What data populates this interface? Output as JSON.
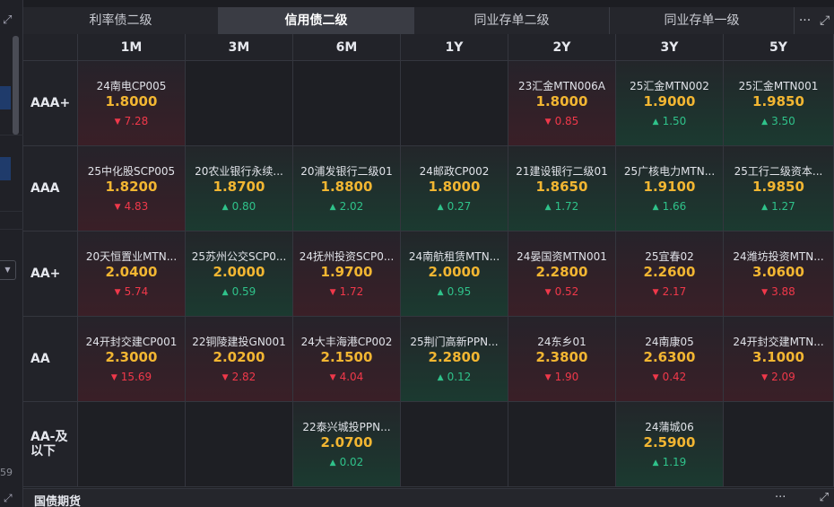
{
  "left": {
    "expand_icon": "expand-icon",
    "number": "59",
    "dropdown_icon": "chevron-down-icon"
  },
  "tabs": [
    {
      "label": "利率债二级",
      "active": false
    },
    {
      "label": "信用债二级",
      "active": true
    },
    {
      "label": "同业存单二级",
      "active": false
    },
    {
      "label": "同业存单一级",
      "active": false
    }
  ],
  "tools": {
    "more": "···",
    "expand": "⤢"
  },
  "columns": [
    "1M",
    "3M",
    "6M",
    "1Y",
    "2Y",
    "3Y",
    "5Y"
  ],
  "rows": [
    {
      "label": "AAA+",
      "cells": [
        {
          "name": "24南电CP005",
          "rate": "1.8000",
          "change": "7.28",
          "dir": "down"
        },
        null,
        null,
        null,
        {
          "name": "23汇金MTN006A",
          "rate": "1.8000",
          "change": "0.85",
          "dir": "down"
        },
        {
          "name": "25汇金MTN002",
          "rate": "1.9000",
          "change": "1.50",
          "dir": "up"
        },
        {
          "name": "25汇金MTN001",
          "rate": "1.9850",
          "change": "3.50",
          "dir": "up"
        }
      ]
    },
    {
      "label": "AAA",
      "cells": [
        {
          "name": "25中化股SCP005",
          "rate": "1.8200",
          "change": "4.83",
          "dir": "down"
        },
        {
          "name": "20农业银行永续...",
          "rate": "1.8700",
          "change": "0.80",
          "dir": "up"
        },
        {
          "name": "20浦发银行二级01",
          "rate": "1.8800",
          "change": "2.02",
          "dir": "up"
        },
        {
          "name": "24邮政CP002",
          "rate": "1.8000",
          "change": "0.27",
          "dir": "up"
        },
        {
          "name": "21建设银行二级01",
          "rate": "1.8650",
          "change": "1.72",
          "dir": "up"
        },
        {
          "name": "25广核电力MTN...",
          "rate": "1.9100",
          "change": "1.66",
          "dir": "up"
        },
        {
          "name": "25工行二级资本...",
          "rate": "1.9850",
          "change": "1.27",
          "dir": "up"
        }
      ]
    },
    {
      "label": "AA+",
      "cells": [
        {
          "name": "20天恒置业MTN...",
          "rate": "2.0400",
          "change": "5.74",
          "dir": "down"
        },
        {
          "name": "25苏州公交SCP0...",
          "rate": "2.0000",
          "change": "0.59",
          "dir": "up"
        },
        {
          "name": "24抚州投资SCP0...",
          "rate": "1.9700",
          "change": "1.72",
          "dir": "down"
        },
        {
          "name": "24南航租赁MTN...",
          "rate": "2.0000",
          "change": "0.95",
          "dir": "up"
        },
        {
          "name": "24晏国资MTN001",
          "rate": "2.2800",
          "change": "0.52",
          "dir": "down"
        },
        {
          "name": "25宜春02",
          "rate": "2.2600",
          "change": "2.17",
          "dir": "down"
        },
        {
          "name": "24潍坊投资MTN...",
          "rate": "3.0600",
          "change": "3.88",
          "dir": "down"
        }
      ]
    },
    {
      "label": "AA",
      "cells": [
        {
          "name": "24开封交建CP001",
          "rate": "2.3000",
          "change": "15.69",
          "dir": "down"
        },
        {
          "name": "22铜陵建投GN001",
          "rate": "2.0200",
          "change": "2.82",
          "dir": "down"
        },
        {
          "name": "24大丰海港CP002",
          "rate": "2.1500",
          "change": "4.04",
          "dir": "down"
        },
        {
          "name": "25荆门高新PPN...",
          "rate": "2.2800",
          "change": "0.12",
          "dir": "up"
        },
        {
          "name": "24东乡01",
          "rate": "2.3800",
          "change": "1.90",
          "dir": "down"
        },
        {
          "name": "24南康05",
          "rate": "2.6300",
          "change": "0.42",
          "dir": "down"
        },
        {
          "name": "24开封交建MTN...",
          "rate": "3.1000",
          "change": "2.09",
          "dir": "down"
        }
      ]
    },
    {
      "label": "AA-及以下",
      "cells": [
        null,
        null,
        {
          "name": "22泰兴城投PPN...",
          "rate": "2.0700",
          "change": "0.02",
          "dir": "up"
        },
        null,
        null,
        {
          "name": "24蒲城06",
          "rate": "2.5900",
          "change": "1.19",
          "dir": "up"
        },
        null
      ]
    }
  ],
  "bottom": {
    "title": "国债期货"
  },
  "colors": {
    "rate": "#f2b632",
    "down": "#f0384a",
    "up": "#2fc28a"
  }
}
